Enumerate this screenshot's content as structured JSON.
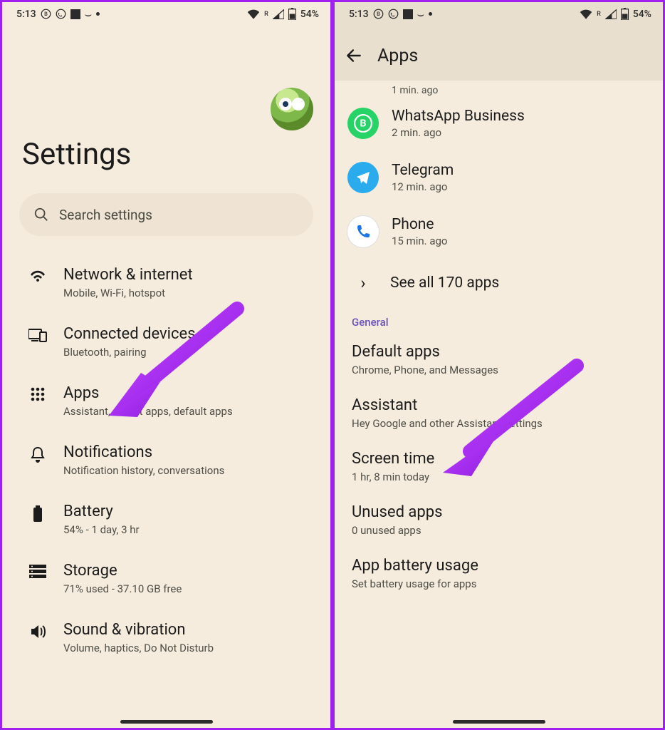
{
  "status": {
    "time": "5:13",
    "battery": "54%",
    "r_indicator": "R"
  },
  "left": {
    "title": "Settings",
    "search_placeholder": "Search settings",
    "items": [
      {
        "title": "Network & internet",
        "sub": "Mobile, Wi-Fi, hotspot"
      },
      {
        "title": "Connected devices",
        "sub": "Bluetooth, pairing"
      },
      {
        "title": "Apps",
        "sub": "Assistant, recent apps, default apps"
      },
      {
        "title": "Notifications",
        "sub": "Notification history, conversations"
      },
      {
        "title": "Battery",
        "sub": "54% - 1 day, 3 hr"
      },
      {
        "title": "Storage",
        "sub": "71% used - 37.10 GB free"
      },
      {
        "title": "Sound & vibration",
        "sub": "Volume, haptics, Do Not Disturb"
      }
    ]
  },
  "right": {
    "header_title": "Apps",
    "truncated_sub": "1 min. ago",
    "apps": [
      {
        "name": "WhatsApp Business",
        "sub": "2 min. ago",
        "icon": "whatsapp-business",
        "color": "#25d366"
      },
      {
        "name": "Telegram",
        "sub": "12 min. ago",
        "icon": "telegram",
        "color": "#2aabee"
      },
      {
        "name": "Phone",
        "sub": "15 min. ago",
        "icon": "phone",
        "color": "#ffffff"
      }
    ],
    "see_all": "See all 170 apps",
    "section": "General",
    "general": [
      {
        "title": "Default apps",
        "sub": "Chrome, Phone, and Messages"
      },
      {
        "title": "Assistant",
        "sub": "Hey Google and other Assistant settings"
      },
      {
        "title": "Screen time",
        "sub": "1 hr, 8 min today"
      },
      {
        "title": "Unused apps",
        "sub": "0 unused apps"
      },
      {
        "title": "App battery usage",
        "sub": "Set battery usage for apps"
      }
    ]
  }
}
